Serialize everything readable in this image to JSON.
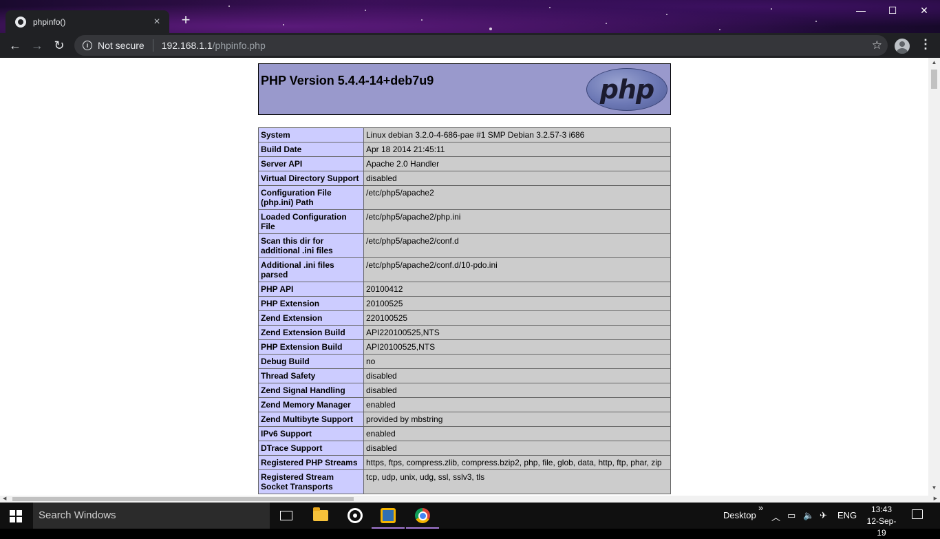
{
  "browser": {
    "tab_title": "phpinfo()",
    "tab_close": "×",
    "new_tab": "+",
    "security_label": "Not secure",
    "url_host": "192.168.1.1",
    "url_path": "/phpinfo.php",
    "window_controls": {
      "minimize": "—",
      "maximize": "☐",
      "close": "✕"
    },
    "nav": {
      "back": "←",
      "forward": "→",
      "reload": "↻",
      "bookmark": "☆",
      "menu": "⋮"
    }
  },
  "page": {
    "heading": "PHP Version 5.4.4-14+deb7u9",
    "logo_text": "php",
    "rows": [
      {
        "key": "System",
        "value": "Linux debian 3.2.0-4-686-pae #1 SMP Debian 3.2.57-3 i686"
      },
      {
        "key": "Build Date",
        "value": "Apr 18 2014 21:45:11"
      },
      {
        "key": "Server API",
        "value": "Apache 2.0 Handler"
      },
      {
        "key": "Virtual Directory Support",
        "value": "disabled"
      },
      {
        "key": "Configuration File (php.ini) Path",
        "value": "/etc/php5/apache2"
      },
      {
        "key": "Loaded Configuration File",
        "value": "/etc/php5/apache2/php.ini"
      },
      {
        "key": "Scan this dir for additional .ini files",
        "value": "/etc/php5/apache2/conf.d"
      },
      {
        "key": "Additional .ini files parsed",
        "value": "/etc/php5/apache2/conf.d/10-pdo.ini"
      },
      {
        "key": "PHP API",
        "value": "20100412"
      },
      {
        "key": "PHP Extension",
        "value": "20100525"
      },
      {
        "key": "Zend Extension",
        "value": "220100525"
      },
      {
        "key": "Zend Extension Build",
        "value": "API220100525,NTS"
      },
      {
        "key": "PHP Extension Build",
        "value": "API20100525,NTS"
      },
      {
        "key": "Debug Build",
        "value": "no"
      },
      {
        "key": "Thread Safety",
        "value": "disabled"
      },
      {
        "key": "Zend Signal Handling",
        "value": "disabled"
      },
      {
        "key": "Zend Memory Manager",
        "value": "enabled"
      },
      {
        "key": "Zend Multibyte Support",
        "value": "provided by mbstring"
      },
      {
        "key": "IPv6 Support",
        "value": "enabled"
      },
      {
        "key": "DTrace Support",
        "value": "disabled"
      },
      {
        "key": "Registered PHP Streams",
        "value": "https, ftps, compress.zlib, compress.bzip2, php, file, glob, data, http, ftp, phar, zip"
      },
      {
        "key": "Registered Stream Socket Transports",
        "value": "tcp, udp, unix, udg, ssl, sslv3, tls"
      }
    ]
  },
  "taskbar": {
    "search_placeholder": "Search Windows",
    "desktop_label": "Desktop",
    "desktop_chevron": "»",
    "language": "ENG",
    "time": "13:43",
    "date": "12-Sep-19",
    "tray_icons": [
      "chevron-up-icon",
      "battery-icon",
      "volume-muted-icon",
      "network-icon"
    ]
  }
}
